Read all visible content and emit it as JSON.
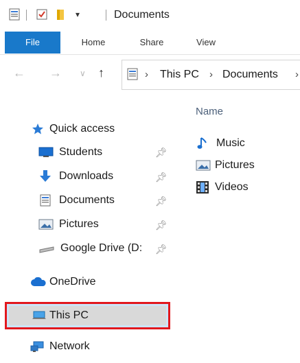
{
  "window": {
    "title": "Documents"
  },
  "ribbon": {
    "tabs": [
      "File",
      "Home",
      "Share",
      "View"
    ]
  },
  "address": {
    "crumbs": [
      "This PC",
      "Documents"
    ]
  },
  "nav": {
    "quick_access": "Quick access",
    "quick_items": [
      {
        "label": "Students",
        "icon": "desktop-icon",
        "pinned": true
      },
      {
        "label": "Downloads",
        "icon": "download-icon",
        "pinned": true
      },
      {
        "label": "Documents",
        "icon": "document-icon",
        "pinned": true
      },
      {
        "label": "Pictures",
        "icon": "pictures-icon",
        "pinned": true
      },
      {
        "label": "Google Drive (D:",
        "icon": "drive-icon",
        "pinned": true
      }
    ],
    "onedrive": "OneDrive",
    "this_pc": "This PC",
    "network": "Network"
  },
  "content": {
    "column_header": "Name",
    "items": [
      {
        "label": "Music",
        "icon": "music-icon"
      },
      {
        "label": "Pictures",
        "icon": "pictures-icon"
      },
      {
        "label": "Videos",
        "icon": "videos-icon"
      }
    ]
  },
  "colors": {
    "accent": "#1979ca",
    "highlight_border": "#e2171d",
    "selection": "#d9d9d9"
  }
}
